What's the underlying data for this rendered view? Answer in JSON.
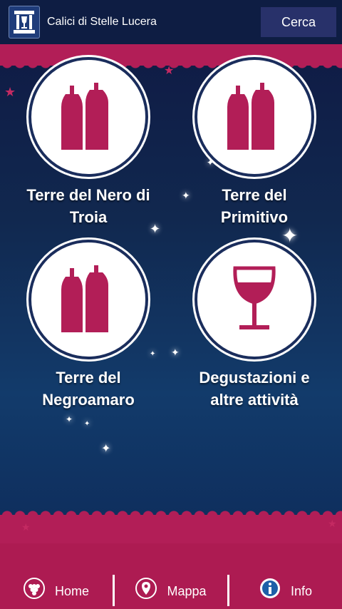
{
  "header": {
    "title": "Calici di Stelle Lucera",
    "search_label": "Cerca",
    "logo_icon": "temple-logo-icon"
  },
  "colors": {
    "crimson": "#b21e57",
    "navy": "#0e1d43",
    "button": "#28316a"
  },
  "tiles": [
    {
      "label": "Terre del Nero di\nTroia",
      "icon": "wine-bottles-icon"
    },
    {
      "label": "Terre del\nPrimitivo",
      "icon": "wine-bottles-icon"
    },
    {
      "label": "Terre del\nNegroamaro",
      "icon": "wine-bottles-icon"
    },
    {
      "label": "Degustazioni e\naltre attività",
      "icon": "wine-glass-icon"
    }
  ],
  "nav": [
    {
      "label": "Home",
      "icon": "grapes-icon"
    },
    {
      "label": "Mappa",
      "icon": "map-pin-icon"
    },
    {
      "label": "Info",
      "icon": "info-icon"
    }
  ]
}
